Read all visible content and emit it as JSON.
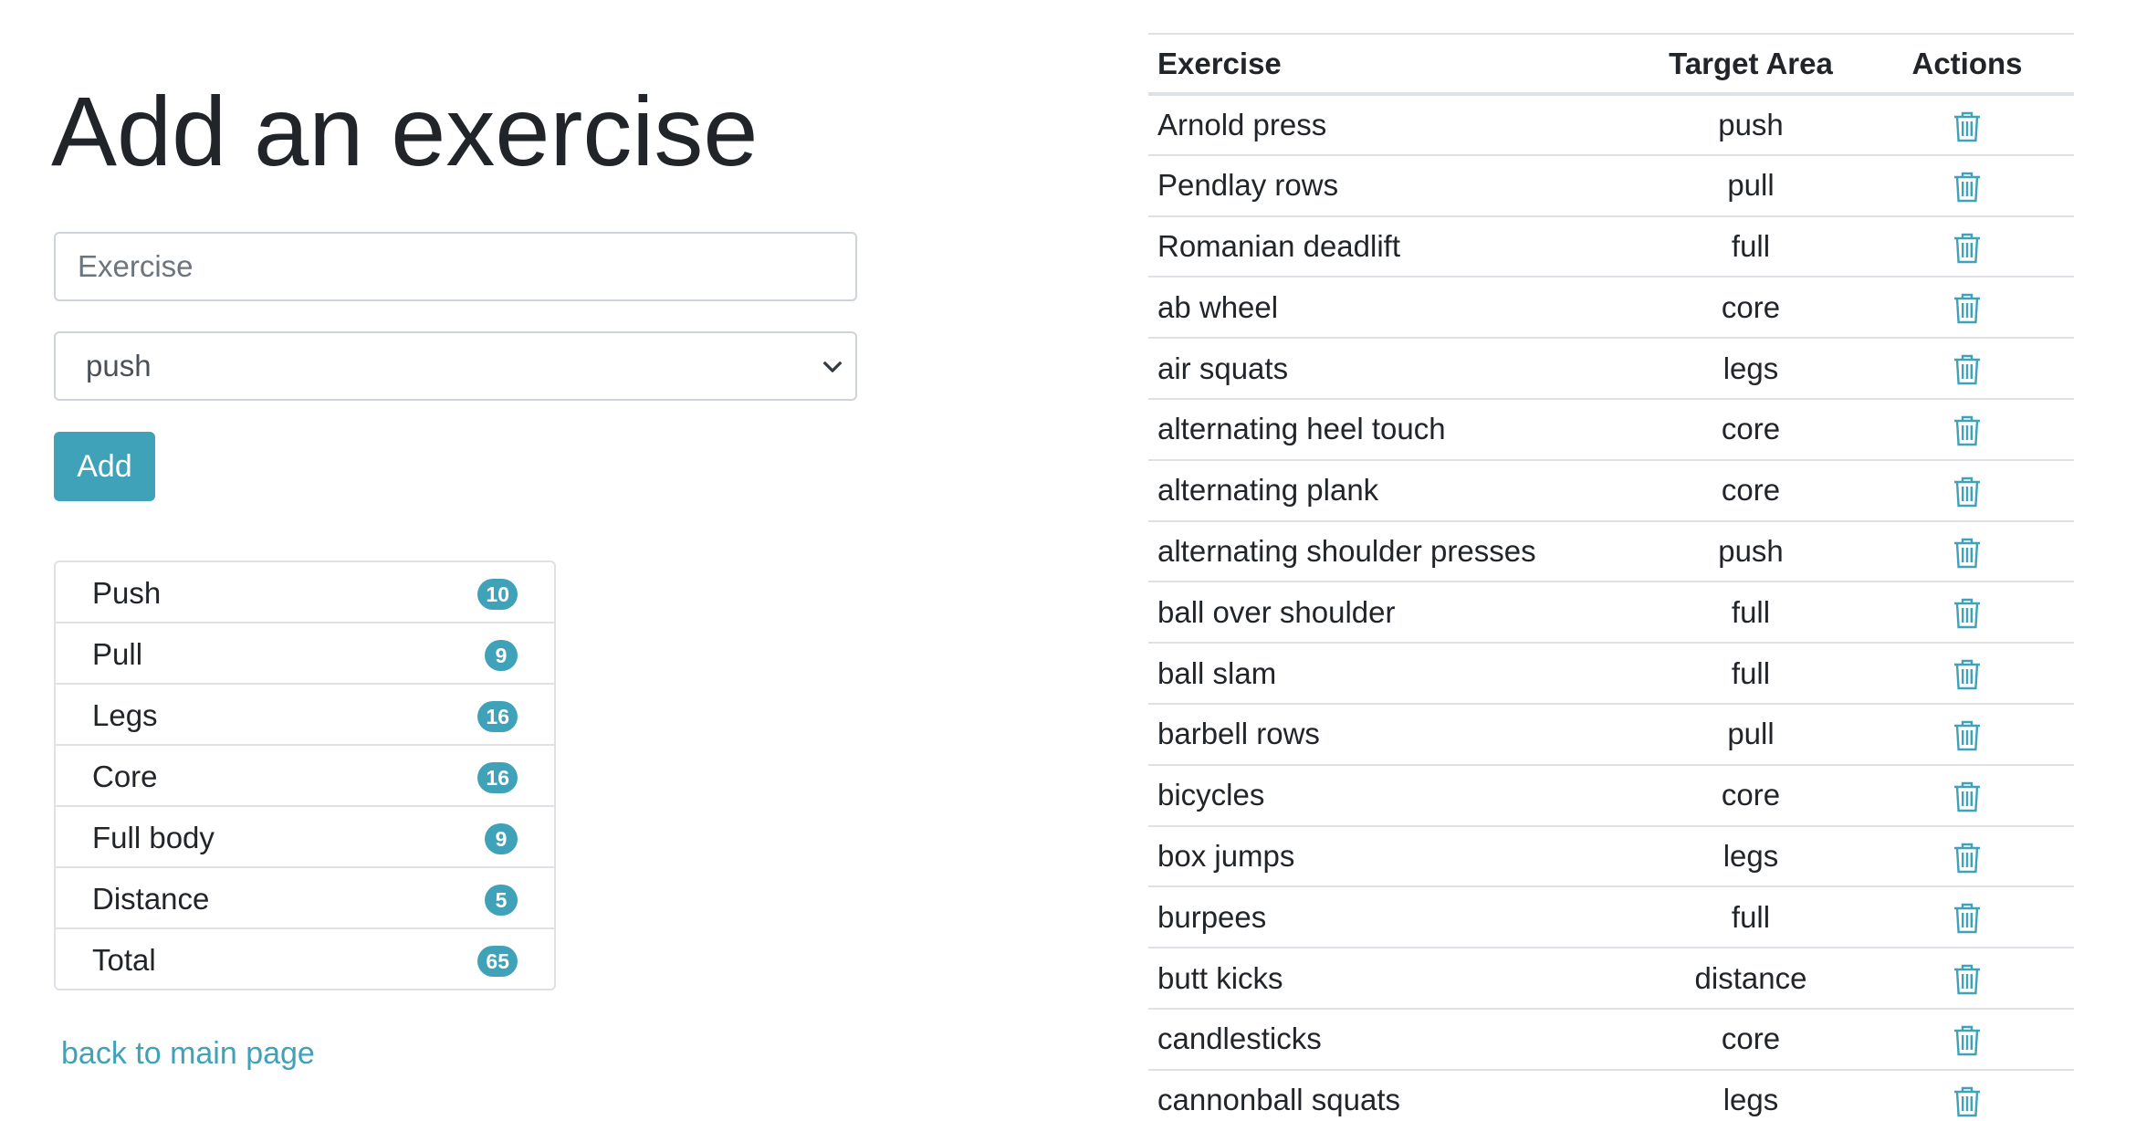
{
  "form": {
    "title": "Add an exercise",
    "exercise_placeholder": "Exercise",
    "exercise_value": "",
    "area_selected": "push",
    "add_label": "Add"
  },
  "summary": [
    {
      "label": "Push",
      "count": "10"
    },
    {
      "label": "Pull",
      "count": "9"
    },
    {
      "label": "Legs",
      "count": "16"
    },
    {
      "label": "Core",
      "count": "16"
    },
    {
      "label": "Full body",
      "count": "9"
    },
    {
      "label": "Distance",
      "count": "5"
    },
    {
      "label": "Total",
      "count": "65"
    }
  ],
  "back_link": "back to main page",
  "table": {
    "headers": {
      "exercise": "Exercise",
      "target": "Target Area",
      "actions": "Actions"
    },
    "rows": [
      {
        "exercise": "Arnold press",
        "target": "push"
      },
      {
        "exercise": "Pendlay rows",
        "target": "pull"
      },
      {
        "exercise": "Romanian deadlift",
        "target": "full"
      },
      {
        "exercise": "ab wheel",
        "target": "core"
      },
      {
        "exercise": "air squats",
        "target": "legs"
      },
      {
        "exercise": "alternating heel touch",
        "target": "core"
      },
      {
        "exercise": "alternating plank",
        "target": "core"
      },
      {
        "exercise": "alternating shoulder presses",
        "target": "push"
      },
      {
        "exercise": "ball over shoulder",
        "target": "full"
      },
      {
        "exercise": "ball slam",
        "target": "full"
      },
      {
        "exercise": "barbell rows",
        "target": "pull"
      },
      {
        "exercise": "bicycles",
        "target": "core"
      },
      {
        "exercise": "box jumps",
        "target": "legs"
      },
      {
        "exercise": "burpees",
        "target": "full"
      },
      {
        "exercise": "butt kicks",
        "target": "distance"
      },
      {
        "exercise": "candlesticks",
        "target": "core"
      },
      {
        "exercise": "cannonball squats",
        "target": "legs"
      }
    ]
  },
  "icons": {
    "row_action": "trash-icon",
    "select_arrow": "chevron-down-icon"
  },
  "colors": {
    "accent": "#3fa2b8",
    "border": "#dee2e6",
    "text": "#212529"
  }
}
